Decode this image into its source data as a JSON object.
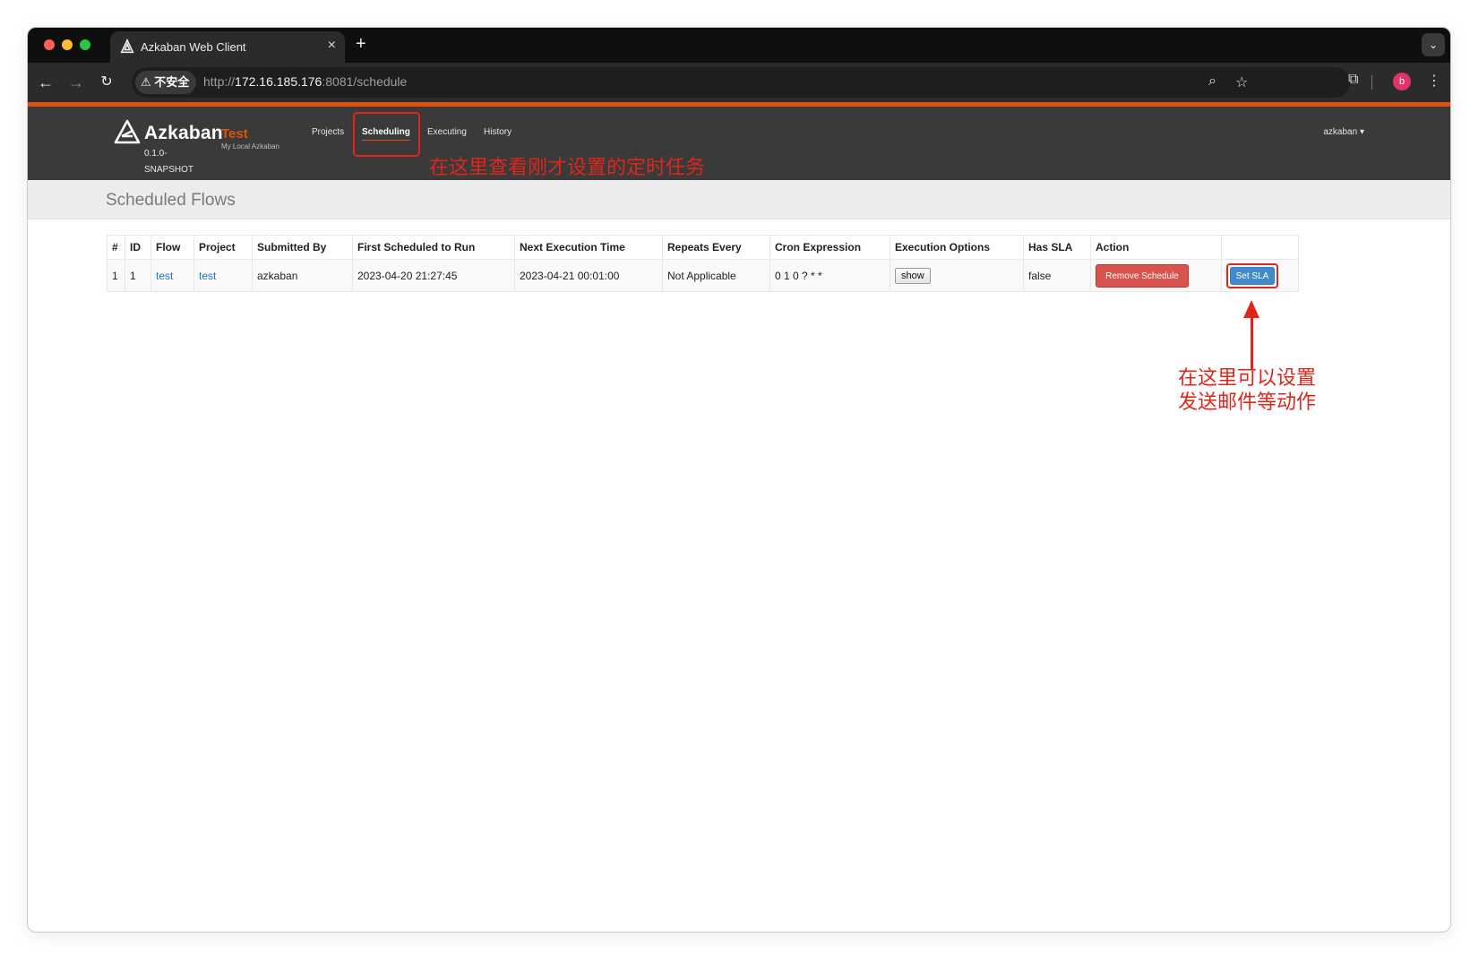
{
  "browser": {
    "tab_title": "Azkaban Web Client",
    "security_label": "不安全",
    "url_scheme": "http://",
    "url_host": "172.16.185.176",
    "url_rest": ":8081/schedule",
    "profile_initial": "b"
  },
  "header": {
    "brand": "Azkaban",
    "version": "0.1.0-SNAPSHOT",
    "env_name": "Test",
    "env_desc": "My Local Azkaban",
    "nav": [
      "Projects",
      "Scheduling",
      "Executing",
      "History"
    ],
    "active_nav": "Scheduling",
    "user": "azkaban"
  },
  "page": {
    "title": "Scheduled Flows"
  },
  "table": {
    "columns": [
      "#",
      "ID",
      "Flow",
      "Project",
      "Submitted By",
      "First Scheduled to Run",
      "Next Execution Time",
      "Repeats Every",
      "Cron Expression",
      "Execution Options",
      "Has SLA",
      "Action"
    ],
    "rows": [
      {
        "num": "1",
        "id": "1",
        "flow": "test",
        "project": "test",
        "submitted_by": "azkaban",
        "first_scheduled": "2023-04-20 21:27:45",
        "next_execution": "2023-04-21 00:01:00",
        "repeats_every": "Not Applicable",
        "cron": "0 1 0 ? * *",
        "exec_options_label": "show",
        "has_sla": "false",
        "remove_label": "Remove Schedule",
        "sla_label": "Set SLA"
      }
    ]
  },
  "annotations": {
    "top": "在这里查看刚才设置的定时任务",
    "right_line1": "在这里可以设置",
    "right_line2": "发送邮件等动作"
  },
  "colors": {
    "accent": "#e2500f",
    "annotation": "#e0251a",
    "link": "#2a72c2",
    "danger": "#d9534f",
    "primary": "#428bca"
  }
}
